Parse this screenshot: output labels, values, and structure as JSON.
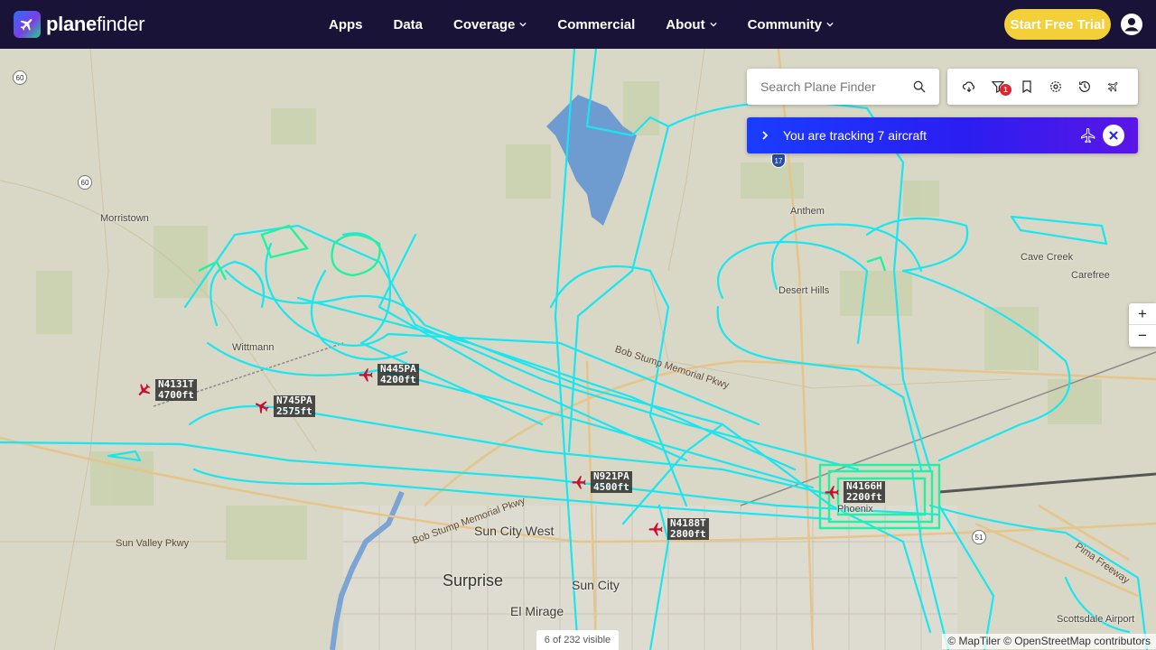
{
  "header": {
    "brand_prefix": "plane",
    "brand_suffix": "finder",
    "nav": [
      {
        "label": "Apps",
        "dropdown": false
      },
      {
        "label": "Data",
        "dropdown": false
      },
      {
        "label": "Coverage",
        "dropdown": true
      },
      {
        "label": "Commercial",
        "dropdown": false
      },
      {
        "label": "About",
        "dropdown": true
      },
      {
        "label": "Community",
        "dropdown": true
      }
    ],
    "trial_button": "Start Free Trial",
    "user_icon": "user-circle-icon"
  },
  "search": {
    "placeholder": "Search Plane Finder",
    "icon": "search-icon"
  },
  "toolbar": {
    "tools": [
      "weather-icon",
      "filter-icon",
      "bookmark-icon",
      "settings-icon",
      "history-icon",
      "tracking-settings-icon"
    ],
    "filter_badge": "1"
  },
  "tracking_banner": {
    "text": "You are tracking 7 aircraft"
  },
  "zoom": {
    "in": "+",
    "out": "−"
  },
  "aircraft": [
    {
      "callsign": "N4131T",
      "altitude": "4700ft"
    },
    {
      "callsign": "N745PA",
      "altitude": "2575ft"
    },
    {
      "callsign": "N445PA",
      "altitude": "4200ft"
    },
    {
      "callsign": "N921PA",
      "altitude": "4500ft"
    },
    {
      "callsign": "N4188T",
      "altitude": "2800ft"
    },
    {
      "callsign": "N4166H",
      "altitude": "2200ft"
    }
  ],
  "places": {
    "morristown": "Morristown",
    "wittmann": "Wittmann",
    "anthem": "Anthem",
    "desert_hills": "Desert Hills",
    "cave_creek": "Cave Creek",
    "carefree": "Carefree",
    "sun_city_west": "Sun City West",
    "surprise": "Surprise",
    "sun_city": "Sun City",
    "el_mirage": "El Mirage",
    "phoenix": "Phoenix",
    "scottsdale_airport": "Scottsdale Airport"
  },
  "roads": {
    "sun_valley": "Sun Valley Pkwy",
    "bob_stump_1": "Bob Stump Memorial Pkwy",
    "bob_stump_2": "Bob Stump Memorial Pkwy",
    "pima": "Pima Freeway"
  },
  "shields": [
    "60",
    "60",
    "17",
    "51"
  ],
  "status": {
    "visible": "6 of 232 visible"
  },
  "attribution": "© MapTiler © OpenStreetMap contributors",
  "colors": {
    "header_bg": "#1a1338",
    "trial": "#f3cf3a",
    "track_cyan": "#19e6f0",
    "track_green": "#22f2a0",
    "aircraft_red": "#c8102e"
  }
}
